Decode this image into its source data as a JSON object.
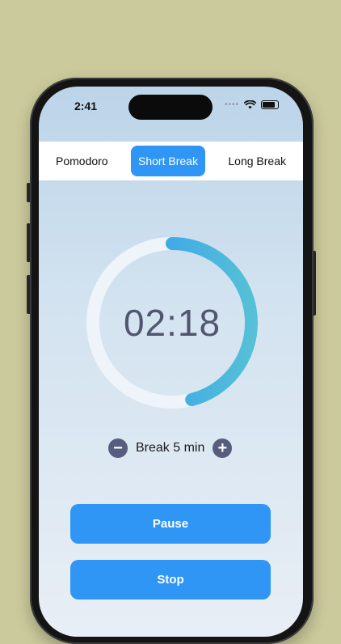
{
  "status_bar": {
    "time": "2:41",
    "dots": "••••"
  },
  "tabs": [
    {
      "label": "Pomodoro",
      "active": false
    },
    {
      "label": "Short Break",
      "active": true
    },
    {
      "label": "Long Break",
      "active": false
    }
  ],
  "timer": {
    "display": "02:18",
    "progress_fraction": 0.46,
    "track_color": "#eef4f9",
    "progress_color_start": "#2f96f5",
    "progress_color_end": "#55c0d6"
  },
  "adjust": {
    "decrement_symbol": "−",
    "label": "Break 5 min",
    "increment_symbol": "+"
  },
  "actions": {
    "pause_label": "Pause",
    "stop_label": "Stop"
  },
  "colors": {
    "background": "#cbca9c",
    "accent": "#2f96f5"
  }
}
